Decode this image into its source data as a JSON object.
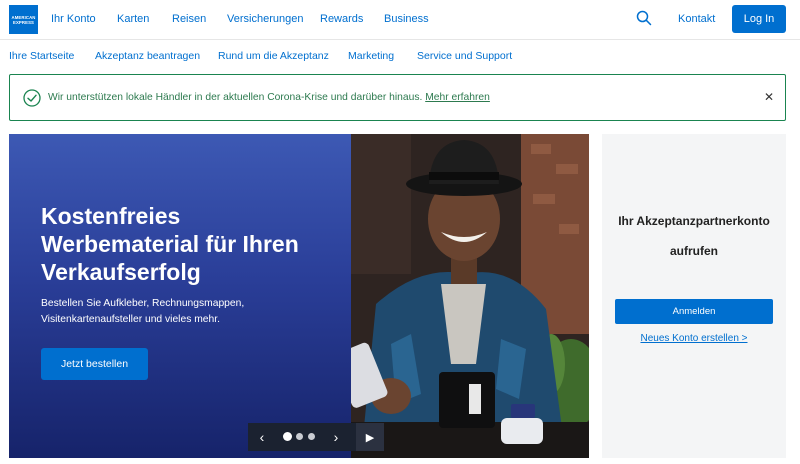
{
  "brand": {
    "logo_line1": "AMERICAN",
    "logo_line2": "EXPRESS",
    "accent": "#006fcf"
  },
  "topnav": {
    "items": [
      "Ihr Konto",
      "Karten",
      "Reisen",
      "Versicherungen",
      "Rewards",
      "Business"
    ],
    "search_icon": "search-icon",
    "contact_label": "Kontakt",
    "login_label": "Log In"
  },
  "subnav": {
    "items": [
      "Ihre Startseite",
      "Akzeptanz beantragen",
      "Rund um die Akzeptanz",
      "Marketing",
      "Service und Support"
    ]
  },
  "alert": {
    "text": "Wir unterstützen lokale Händler in der aktuellen Corona-Krise und darüber hinaus.",
    "link_label": "Mehr erfahren",
    "close_glyph": "✕",
    "color": "#1a8450"
  },
  "hero": {
    "title": "Kostenfreies Werbematerial für Ihren Verkaufserfolg",
    "subtitle": "Bestellen Sie Aufkleber, Rechnungsmappen, Visitenkartenaufsteller und vieles mehr.",
    "cta_label": "Jetzt bestellen",
    "carousel": {
      "prev_glyph": "‹",
      "next_glyph": "›",
      "play_glyph": "▶",
      "slides": 3,
      "active_slide": 1
    }
  },
  "panel": {
    "title": "Ihr Akzeptanzpartnerkonto aufrufen",
    "login_label": "Anmelden",
    "create_link": "Neues Konto erstellen >"
  }
}
